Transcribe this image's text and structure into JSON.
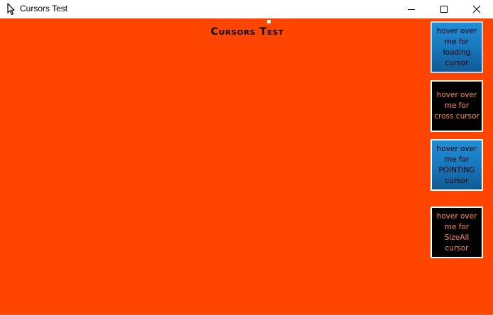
{
  "window": {
    "title": "Cursors Test",
    "icon": "cursor-arrow-icon",
    "controls": {
      "minimize": "minimize-icon",
      "maximize": "maximize-icon",
      "close": "close-icon"
    }
  },
  "page": {
    "heading": "Cursors Test",
    "background_color": "#ff4500"
  },
  "buttons": [
    {
      "label": "hover over me for loading cursor",
      "style": "blue"
    },
    {
      "label": "hover over me for cross cursor",
      "style": "dark"
    },
    {
      "label": "hover over me for POINTING cursor",
      "style": "blue"
    },
    {
      "label": "hover over me for SizeAll cursor",
      "style": "dark"
    }
  ]
}
